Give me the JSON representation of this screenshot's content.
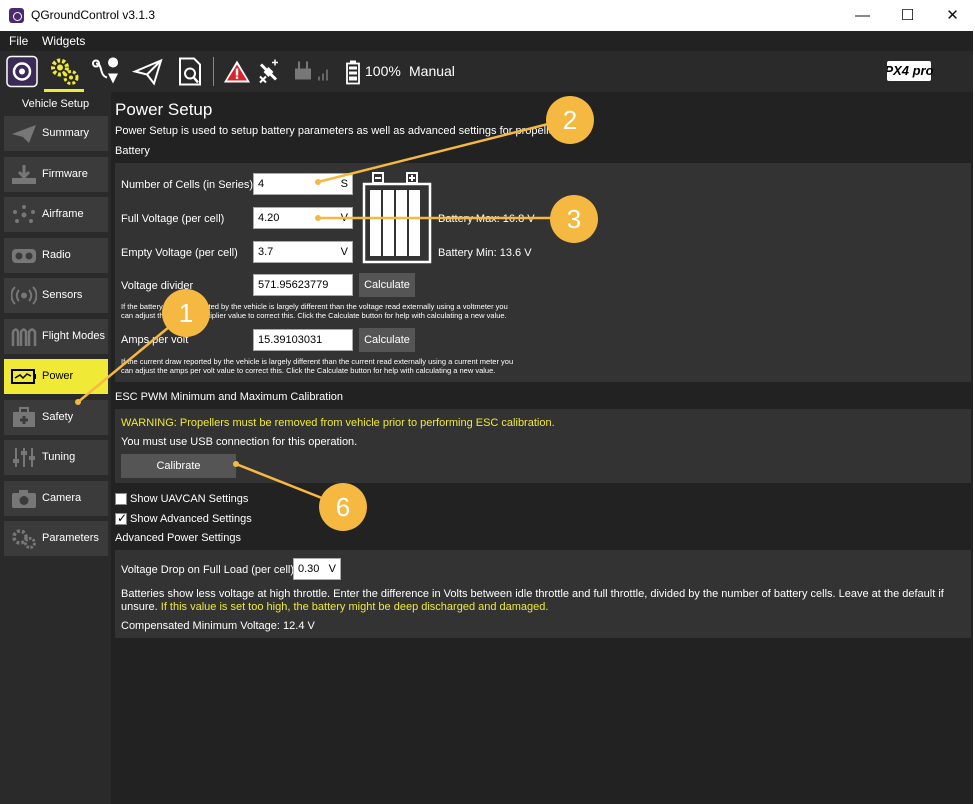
{
  "window": {
    "title": "QGroundControl v3.1.3",
    "minimize": "—",
    "maximize": "☐",
    "close": "✕"
  },
  "menu": {
    "file": "File",
    "widgets": "Widgets"
  },
  "toolbar": {
    "battery": "100%",
    "mode": "Manual",
    "brand": "PX4 pro"
  },
  "sidebar": {
    "header": "Vehicle Setup",
    "items": [
      {
        "label": "Summary",
        "icon": "paper-plane-icon"
      },
      {
        "label": "Firmware",
        "icon": "download-icon"
      },
      {
        "label": "Airframe",
        "icon": "airframe-icon"
      },
      {
        "label": "Radio",
        "icon": "radio-icon"
      },
      {
        "label": "Sensors",
        "icon": "sensors-icon"
      },
      {
        "label": "Flight Modes",
        "icon": "flight-modes-icon"
      },
      {
        "label": "Power",
        "icon": "power-icon",
        "active": true
      },
      {
        "label": "Safety",
        "icon": "safety-icon"
      },
      {
        "label": "Tuning",
        "icon": "tuning-icon"
      },
      {
        "label": "Camera",
        "icon": "camera-icon"
      },
      {
        "label": "Parameters",
        "icon": "gears-icon"
      }
    ]
  },
  "main": {
    "title": "Power Setup",
    "description": "Power Setup is used to setup battery parameters as well as advanced settings for propellers.",
    "battery": {
      "section": "Battery",
      "cells_label": "Number of Cells (in Series)",
      "cells_value": "4",
      "cells_unit": "S",
      "full_label": "Full Voltage (per cell)",
      "full_value": "4.20",
      "full_unit": "V",
      "empty_label": "Empty Voltage (per cell)",
      "empty_value": "3.7",
      "empty_unit": "V",
      "battery_max": "Battery Max:  16.8 V",
      "battery_min": "Battery Min:  13.6 V",
      "divider_label": "Voltage divider",
      "divider_value": "571.95623779",
      "calculate": "Calculate",
      "divider_help_1": "If the battery voltage reported by the vehicle is largely different than the voltage read externally using a voltmeter you",
      "divider_help_2": "can adjust the voltage multiplier value to correct this. Click the Calculate button for help with calculating a new value.",
      "amps_label": "Amps per volt",
      "amps_value": "15.39103031",
      "amps_help_1": "If the current draw reported by the vehicle is largely different than the current read externally using a current meter you",
      "amps_help_2": "can adjust the amps per volt value to correct this. Click the Calculate button for help with calculating a new value."
    },
    "esc": {
      "section": "ESC PWM Minimum and Maximum Calibration",
      "warning": "WARNING: Propellers must be removed from vehicle prior to performing ESC calibration.",
      "usb_note": "You must use USB connection for this operation.",
      "calibrate": "Calibrate"
    },
    "show_uavcan": "Show UAVCAN Settings",
    "show_advanced": "Show Advanced Settings",
    "advanced": {
      "section": "Advanced Power Settings",
      "vdrop_label": "Voltage Drop on Full Load (per cell)",
      "vdrop_value": "0.30",
      "vdrop_unit": "V",
      "help_1": "Batteries show less voltage at high throttle. Enter the difference in Volts between idle throttle and full throttle, divided by the number of battery cells. Leave at the default if",
      "help_2a": "unsure.",
      "help_2b": " If this value is set too high, the battery might be deep discharged and damaged.",
      "compensated": "Compensated Minimum Voltage:  12.4 V"
    }
  },
  "callouts": [
    "1",
    "2",
    "3",
    "6"
  ],
  "colors": {
    "accent": "#f0e936",
    "callout": "#f5b942",
    "background": "#222222"
  }
}
